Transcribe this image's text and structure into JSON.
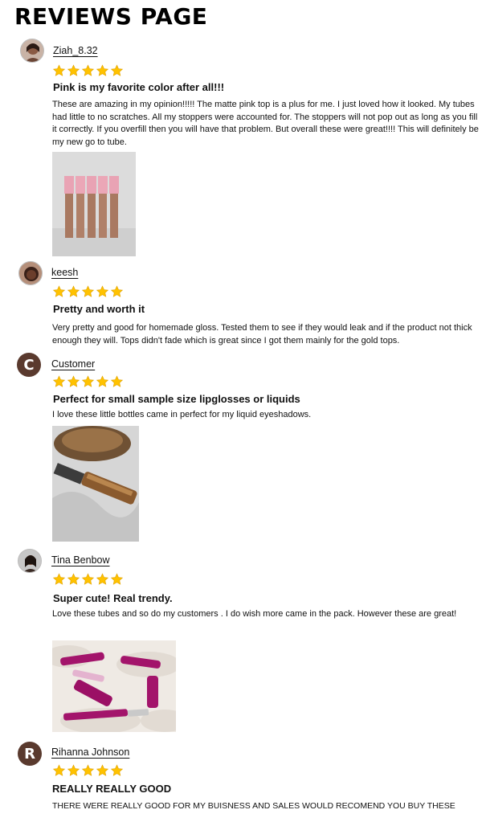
{
  "page": {
    "title": "REVIEWS PAGE"
  },
  "reviews": [
    {
      "reviewer": "Ziah_8.32",
      "rating": 5,
      "title": "Pink is my favorite color after all!!!",
      "body": "These are amazing in my opinion!!!!! The matte pink top is a plus for me. I just loved how it looked. My tubes had little to no scratches. All my stoppers were accounted for. The stoppers will not pop out as long as you fill it correctly. If you overfill then you will have that problem. But overall these were great!!!! This will definitely be my new go to tube."
    },
    {
      "reviewer": "keesh",
      "rating": 5,
      "title": "Pretty and worth it",
      "body": "Very pretty and good for homemade gloss. Tested them to see if they would leak and if the product not thick enough they will. Tops didn't fade which is great since I got them mainly for the gold tops."
    },
    {
      "reviewer": "Customer",
      "avatar_letter": "C",
      "rating": 5,
      "title": "Perfect for small sample size lipglosses or liquids",
      "body": "I love these little bottles came in perfect for my liquid eyeshadows."
    },
    {
      "reviewer": "Tina Benbow",
      "rating": 5,
      "title": "Super cute! Real trendy.",
      "body": "Love these tubes and so do my customers . I do wish more came in the pack. However these are great!"
    },
    {
      "reviewer": "Rihanna Johnson",
      "avatar_letter": "R",
      "rating": 5,
      "title": "REALLY REALLY GOOD",
      "body": "THERE WERE REALLY GOOD FOR MY BUISNESS AND SALES WOULD RECOMEND YOU BUY THESE"
    }
  ],
  "colors": {
    "star": "#FFC200",
    "star_stroke": "#E3A500",
    "avatar_letter_bg": "#5a3a2e"
  }
}
